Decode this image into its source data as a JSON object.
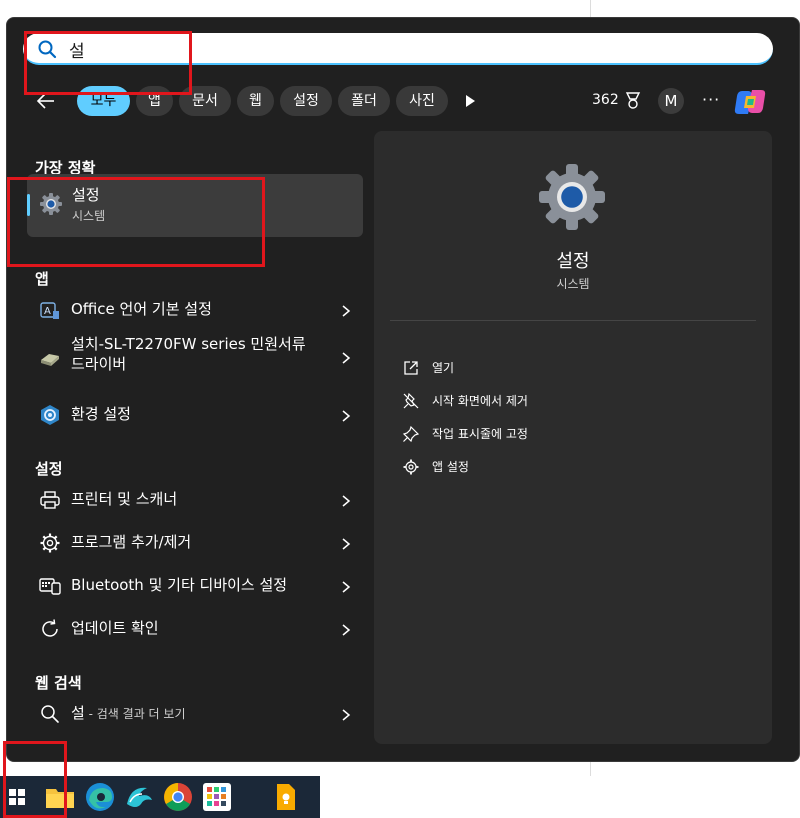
{
  "search": {
    "query": "설"
  },
  "filters": [
    {
      "label": "모두",
      "active": true
    },
    {
      "label": "앱",
      "active": false
    },
    {
      "label": "문서",
      "active": false
    },
    {
      "label": "웹",
      "active": false
    },
    {
      "label": "설정",
      "active": false
    },
    {
      "label": "폴더",
      "active": false
    },
    {
      "label": "사진",
      "active": false
    }
  ],
  "header": {
    "points": "362",
    "avatar_initial": "M",
    "more": "···"
  },
  "sections": {
    "best_match": "가장 정확",
    "apps": "앱",
    "settings": "설정",
    "web": "웹 검색"
  },
  "best_match": {
    "title": "설정",
    "subtitle": "시스템"
  },
  "apps": [
    {
      "label": "Office 언어 기본 설정",
      "icon": "office-language-icon"
    },
    {
      "label": "설치-SL-T2270FW series 민원서류",
      "label2": "드라이버",
      "icon": "installer-icon"
    },
    {
      "label": "환경 설정",
      "icon": "preferences-icon"
    }
  ],
  "settings_items": [
    {
      "label": "프린터 및 스캐너",
      "icon": "printer-icon"
    },
    {
      "label": "프로그램 추가/제거",
      "icon": "gear-icon"
    },
    {
      "label": "Bluetooth 및 기타 디바이스 설정",
      "icon": "devices-icon"
    },
    {
      "label": "업데이트 확인",
      "icon": "refresh-icon"
    }
  ],
  "web": {
    "query": "설",
    "suffix": " - 검색 결과 더 보기"
  },
  "detail": {
    "title": "설정",
    "subtitle": "시스템",
    "actions": [
      {
        "label": "열기",
        "icon": "open-external-icon"
      },
      {
        "label": "시작 화면에서 제거",
        "icon": "unpin-icon"
      },
      {
        "label": "작업 표시줄에 고정",
        "icon": "pin-icon"
      },
      {
        "label": "앱 설정",
        "icon": "gear-icon"
      }
    ]
  },
  "colors": {
    "accent": "#60cdff",
    "panel": "#202020",
    "highlight": "#e0161c"
  }
}
